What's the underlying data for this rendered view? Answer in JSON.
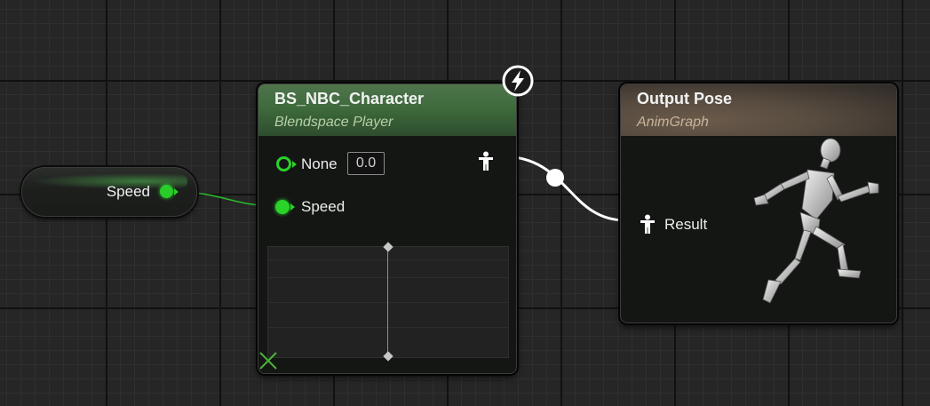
{
  "speed_variable": {
    "label": "Speed"
  },
  "blendspace_node": {
    "title": "BS_NBC_Character",
    "subtitle": "Blendspace Player",
    "inputs": [
      {
        "label": "None",
        "value": "0.0"
      },
      {
        "label": "Speed"
      }
    ]
  },
  "output_node": {
    "title": "Output Pose",
    "subtitle": "AnimGraph",
    "input_label": "Result"
  },
  "colors": {
    "float_pin": "#2ad22a",
    "blendspace_header": "#3e6b3c",
    "output_header": "#584c40",
    "pose_wire": "#ffffff"
  }
}
